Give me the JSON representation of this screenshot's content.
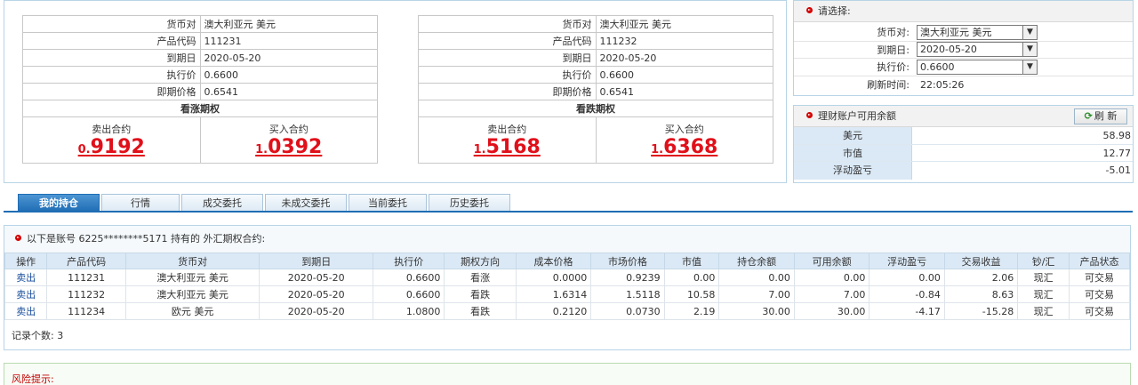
{
  "call_put_panels": [
    {
      "fields": [
        {
          "key": "货币对",
          "value": "澳大利亚元 美元"
        },
        {
          "key": "产品代码",
          "value": "111231"
        },
        {
          "key": "到期日",
          "value": "2020-05-20"
        },
        {
          "key": "执行价",
          "value": "0.6600"
        },
        {
          "key": "即期价格",
          "value": "0.6541"
        }
      ],
      "title": "看涨期权",
      "sell_label": "卖出合约",
      "sell_small": "0.",
      "sell_big": "9192",
      "buy_label": "买入合约",
      "buy_small": "1.",
      "buy_big": "0392"
    },
    {
      "fields": [
        {
          "key": "货币对",
          "value": "澳大利亚元 美元"
        },
        {
          "key": "产品代码",
          "value": "111232"
        },
        {
          "key": "到期日",
          "value": "2020-05-20"
        },
        {
          "key": "执行价",
          "value": "0.6600"
        },
        {
          "key": "即期价格",
          "value": "0.6541"
        }
      ],
      "title": "看跌期权",
      "sell_label": "卖出合约",
      "sell_small": "1.",
      "sell_big": "5168",
      "buy_label": "买入合约",
      "buy_small": "1.",
      "buy_big": "6368"
    }
  ],
  "selector": {
    "title": "请选择:",
    "rows": [
      {
        "label": "货币对:",
        "value": "澳大利亚元 美元"
      },
      {
        "label": "到期日:",
        "value": "2020-05-20"
      },
      {
        "label": "执行价:",
        "value": "0.6600"
      }
    ],
    "refresh_label": "刷新时间:",
    "refresh_time": "22:05:26"
  },
  "balance": {
    "title": "理财账户可用余额",
    "refresh_button": "刷 新",
    "rows": [
      {
        "label": "美元",
        "value": "58.98"
      },
      {
        "label": "市值",
        "value": "12.77"
      },
      {
        "label": "浮动盈亏",
        "value": "-5.01"
      }
    ]
  },
  "tabs": [
    "我的持仓",
    "行情",
    "成交委托",
    "未成交委托",
    "当前委托",
    "历史委托"
  ],
  "holdings": {
    "heading": "以下是账号 6225********5171 持有的 外汇期权合约:",
    "columns": [
      "操作",
      "产品代码",
      "货币对",
      "到期日",
      "执行价",
      "期权方向",
      "成本价格",
      "市场价格",
      "市值",
      "持仓余额",
      "可用余额",
      "浮动盈亏",
      "交易收益",
      "钞/汇",
      "产品状态"
    ],
    "rows": [
      [
        "卖出",
        "111231",
        "澳大利亚元 美元",
        "2020-05-20",
        "0.6600",
        "看涨",
        "0.0000",
        "0.9239",
        "0.00",
        "0.00",
        "0.00",
        "0.00",
        "2.06",
        "现汇",
        "可交易"
      ],
      [
        "卖出",
        "111232",
        "澳大利亚元 美元",
        "2020-05-20",
        "0.6600",
        "看跌",
        "1.6314",
        "1.5118",
        "10.58",
        "7.00",
        "7.00",
        "-0.84",
        "8.63",
        "现汇",
        "可交易"
      ],
      [
        "卖出",
        "111234",
        "欧元 美元",
        "2020-05-20",
        "1.0800",
        "看跌",
        "0.2120",
        "0.0730",
        "2.19",
        "30.00",
        "30.00",
        "-4.17",
        "-15.28",
        "现汇",
        "可交易"
      ]
    ],
    "record_label": "记录个数:",
    "record_count": "3"
  },
  "risk": {
    "title": "风险提示:"
  },
  "colors": {
    "price_red": "#e0101a",
    "tab_active": "#1f6db4",
    "header_bg": "#dbe9f6"
  }
}
